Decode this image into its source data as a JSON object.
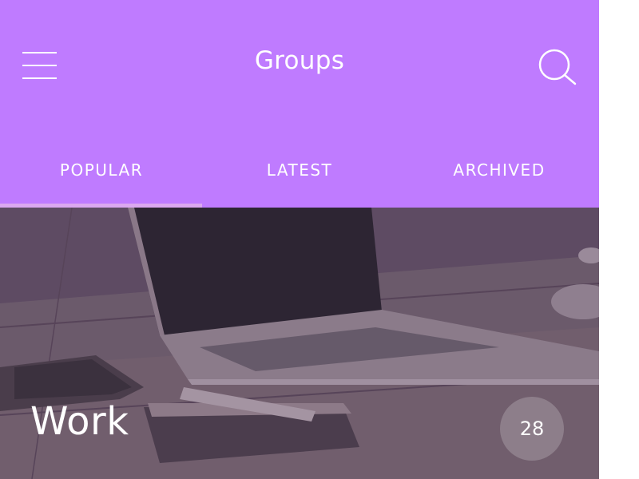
{
  "header": {
    "title": "Groups",
    "background_color": "#bf7bff",
    "menu_icon": "hamburger-menu-icon",
    "search_icon": "search-icon"
  },
  "tabs": [
    {
      "label": "POPULAR",
      "active": true
    },
    {
      "label": "LATEST",
      "active": false
    },
    {
      "label": "ARCHIVED",
      "active": false
    }
  ],
  "indicator_color": "#dba8f0",
  "cards": [
    {
      "title": "Work",
      "count": "28",
      "image": "laptop-on-desk-photo"
    }
  ]
}
